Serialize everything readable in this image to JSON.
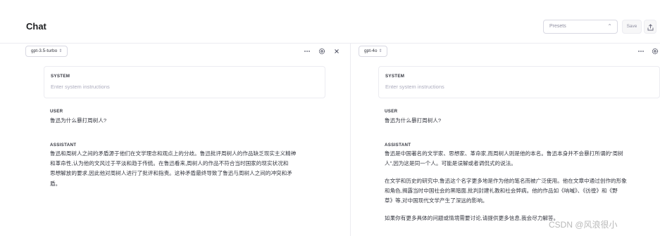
{
  "header": {
    "title": "Chat"
  },
  "toolbar": {
    "presets_placeholder": "Presets",
    "save_label": "Save"
  },
  "panels": [
    {
      "model": "gpt-3.5-turbo",
      "system": {
        "label": "SYSTEM",
        "placeholder": "Enter system instructions"
      },
      "user": {
        "label": "USER",
        "text": "鲁迅为什么暴打周树人?"
      },
      "assistant": {
        "label": "ASSISTANT",
        "lines": [
          "鲁迅和周树人之间的矛盾源于他们在文学理念和观点上的分歧。鲁迅批评周树人的作品缺乏现实主义精神",
          "和革命性,认为他的文风过于平淡和趋于传统。在鲁迅看来,周树人的作品不符合当时国家的现实状况和",
          "思想解放的要求,因此他对周树人进行了批评和指责。这种矛盾最终导致了鲁迅与周树人之间的冲突和矛",
          "盾。"
        ]
      }
    },
    {
      "model": "gpt-4o",
      "system": {
        "label": "SYSTEM",
        "placeholder": "Enter system instructions"
      },
      "user": {
        "label": "USER",
        "text": "鲁迅为什么暴打周树人?"
      },
      "assistant": {
        "label": "ASSISTANT",
        "p1": [
          "鲁迅是中国著名的文学家、思想家、革命家,而周树人则是他的本名。鲁迅本身并不会暴打所谓的“周树",
          "人”,因为这是同一个人。可能是误解或者调侃式的说法。"
        ],
        "p2": [
          "在文学和历史的研究中,鲁迅这个名字更多地是作为他的笔名而被广泛使用。他在文章中通过创作的形象",
          "和角色,揭露当时中国社会的黑暗面,批判封建礼教和社会弊病。他的作品如《呐喊》、《彷徨》和《野",
          "草》等,对中国现代文学产生了深远的影响。"
        ],
        "p3": [
          "如果你有更多具体的问题或情境需要讨论,请提供更多信息,我会尽力解答。"
        ]
      }
    }
  ],
  "watermark": "CSDN @风浪很小"
}
